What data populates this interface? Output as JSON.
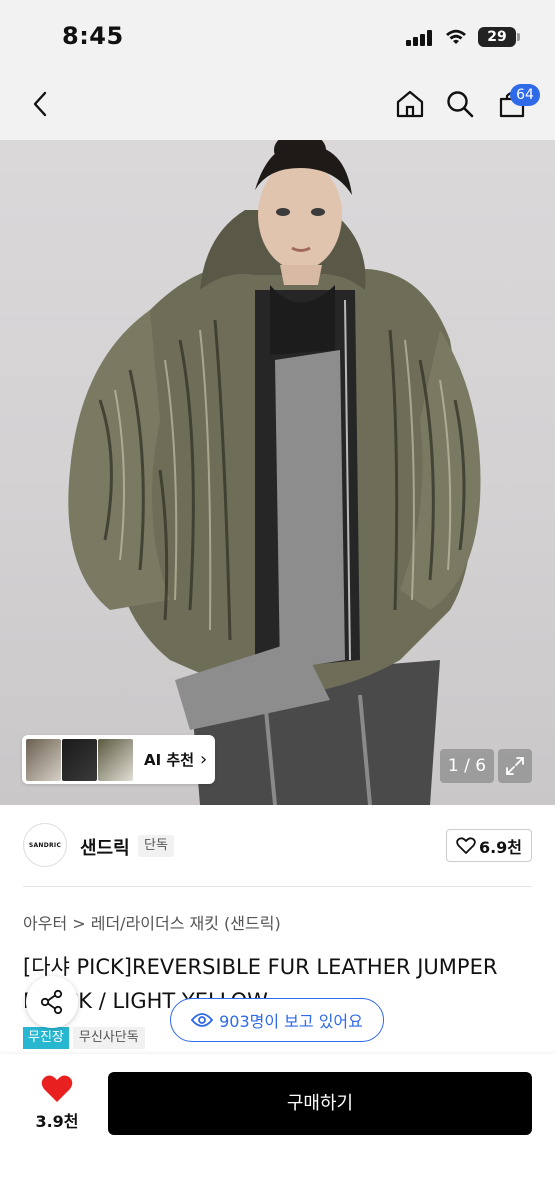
{
  "status_bar": {
    "time": "8:45",
    "battery": "29"
  },
  "header": {
    "cart_count": "64"
  },
  "gallery": {
    "ai_label": "AI 추천",
    "ai_chevron": "›",
    "page_indicator": "1 / 6"
  },
  "brand": {
    "logo_text": "SANDRIC",
    "name": "샌드릭",
    "tag": "단독",
    "likes": "6.9천"
  },
  "product": {
    "breadcrumb": "아우터 > 레더/라이더스 재킷 (샌드릭)",
    "title": "[다샤 PICK]REVERSIBLE FUR LEATHER JUMPER BLACK / LIGHT YELLOW",
    "tags": [
      "무진장",
      "무신사단독"
    ],
    "viewers": "903명이 보고 있어요"
  },
  "bottom_bar": {
    "favorite_count": "3.9천",
    "buy_label": "구매하기"
  },
  "colors": {
    "accent_blue": "#2f6ae8",
    "tag_cyan": "#27b7d1",
    "heart_red": "#e8201f",
    "buy_black": "#000000"
  },
  "icons": [
    "back-icon",
    "home-icon",
    "search-icon",
    "cart-icon",
    "expand-icon",
    "heart-icon",
    "share-icon",
    "eye-icon"
  ]
}
